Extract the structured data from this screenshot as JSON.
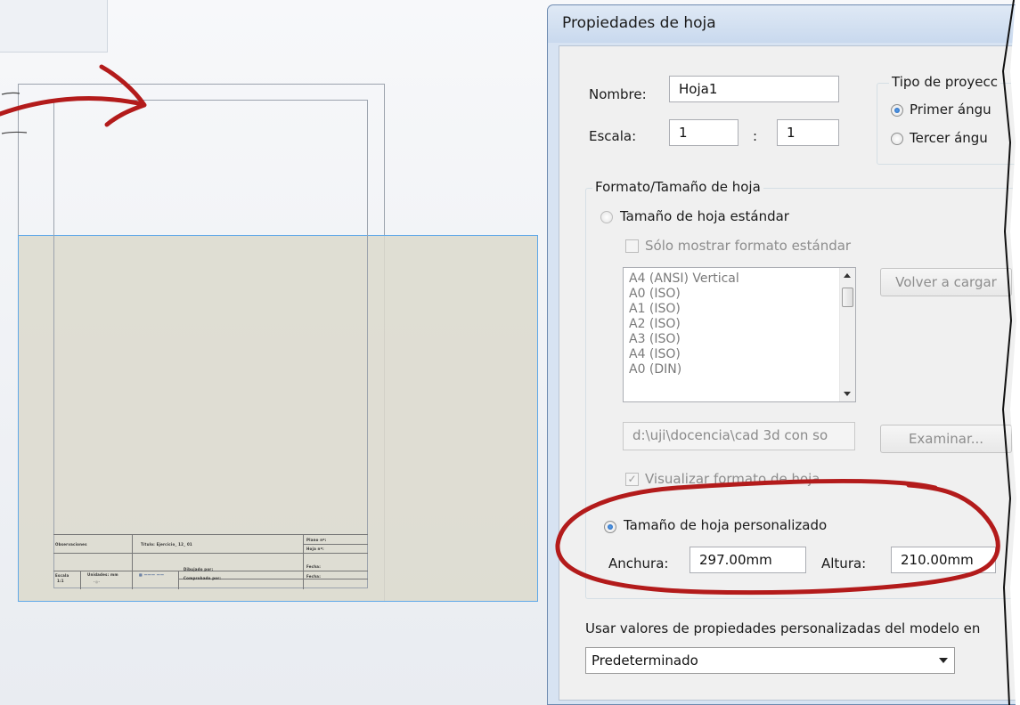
{
  "drawing": {
    "title_block": {
      "observaciones": "Observaciones",
      "titulo": "Título: Ejercicio_ 12_ 01",
      "plano": "Plano nº:",
      "hoja": "Hoja nº:",
      "escala_label": "Escala",
      "escala_value": "1:1",
      "unidades": "Unidades: mm",
      "dibujado": "Dibujado por:",
      "comprobado": "Comprobado por:",
      "fecha1": "Fecha:",
      "fecha2": "Fecha:"
    }
  },
  "dialog": {
    "title": "Propiedades de hoja",
    "nombre_label": "Nombre:",
    "nombre_value": "Hoja1",
    "escala_label": "Escala:",
    "escala_num": "1",
    "escala_sep": ":",
    "escala_den": "1",
    "proyeccion": {
      "label": "Tipo de proyecc",
      "primer": "Primer ángu",
      "tercer": "Tercer ángu",
      "selected": "primer"
    },
    "formato": {
      "label": "Formato/Tamaño de hoja",
      "estandar_label": "Tamaño de hoja estándar",
      "solo_estandar": "Sólo mostrar formato estándar",
      "sizes": [
        "A4 (ANSI) Vertical",
        "A0 (ISO)",
        "A1 (ISO)",
        "A2 (ISO)",
        "A3 (ISO)",
        "A4 (ISO)",
        "A0 (DIN)"
      ],
      "recargar": "Volver a cargar",
      "path": "d:\\uji\\docencia\\cad 3d con so",
      "examinar": "Examinar...",
      "visualizar": "Visualizar formato de hoja",
      "visualizar_checked": true,
      "personalizado_label": "Tamaño de hoja personalizado",
      "selected": "personalizado",
      "anchura_label": "Anchura:",
      "anchura_value": "297.00mm",
      "altura_label": "Altura:",
      "altura_value": "210.00mm"
    },
    "usar_label": "Usar valores de propiedades personalizadas del modelo en",
    "usar_select": "Predeterminado"
  },
  "colors": {
    "annotation_red": "#b31b1b",
    "selection_blue": "#5fa8e8",
    "sheet_fill": "#dcd9cc"
  }
}
